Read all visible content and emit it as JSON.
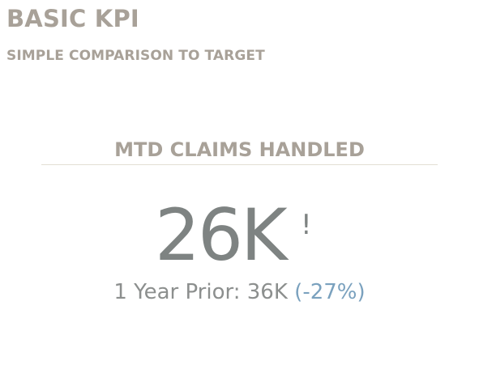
{
  "page": {
    "title": "BASIC KPI",
    "subtitle": "SIMPLE COMPARISON TO TARGET"
  },
  "kpi": {
    "title": "MTD CLAIMS HANDLED",
    "value": "26K",
    "alert": "!",
    "comparison_label": "1 Year Prior: 36K",
    "change": "(-27%)"
  },
  "colors": {
    "heading": "#a8a198",
    "value": "#7e8382",
    "change": "#7aa1be",
    "divider": "#e3ded4"
  }
}
